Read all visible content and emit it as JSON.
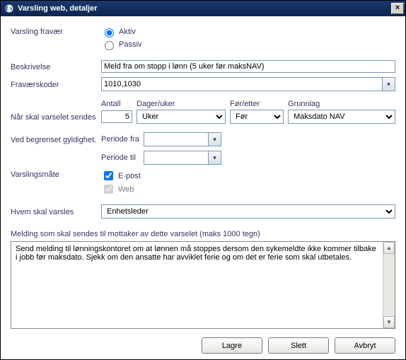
{
  "window": {
    "title": "Varsling web, detaljer",
    "close_symbol": "×"
  },
  "labels": {
    "varsling_fravaer": "Varsling fravær",
    "aktiv": "Aktiv",
    "passiv": "Passiv",
    "beskrivelse": "Beskrivelse",
    "fravaerskoder": "Fraværskoder",
    "antall": "Antall",
    "dager_uker": "Dager/uker",
    "for_etter": "Før/etter",
    "grunnlag": "Grunnlag",
    "naar_sendes": "Når skal varselet sendes",
    "begrenset_gyldighet": "Ved begrenset gyldighet.",
    "periode_fra": "Periode fra",
    "periode_til": "Periode til",
    "varslingsmaate": "Varslingsmåte",
    "epost": "E-post",
    "web": "Web",
    "hvem_varsles": "Hvem skal varsles",
    "melding_header": "Melding som skal sendes til mottaker av dette varselet (maks 1000 tegn)"
  },
  "values": {
    "beskrivelse": "Meld fra om stopp i lønn (5 uker før maksNAV)",
    "fravaerskoder": "1010,1030",
    "antall": "5",
    "dager_uker": "Uker",
    "for_etter": "Før",
    "grunnlag": "Maksdato NAV",
    "periode_fra": "",
    "periode_til": "",
    "epost_checked": true,
    "web_checked": true,
    "hvem_varsles": "Enhetsleder",
    "melding": "Send melding til lønningskontoret om at lønnen må stoppes dersom den sykemeldte ikke kommer tilbake i jobb før maksdato. Sjekk om den ansatte har avviklet ferie og om det er ferie som skal utbetales."
  },
  "buttons": {
    "lagre": "Lagre",
    "slett": "Slett",
    "avbryt": "Avbryt"
  }
}
